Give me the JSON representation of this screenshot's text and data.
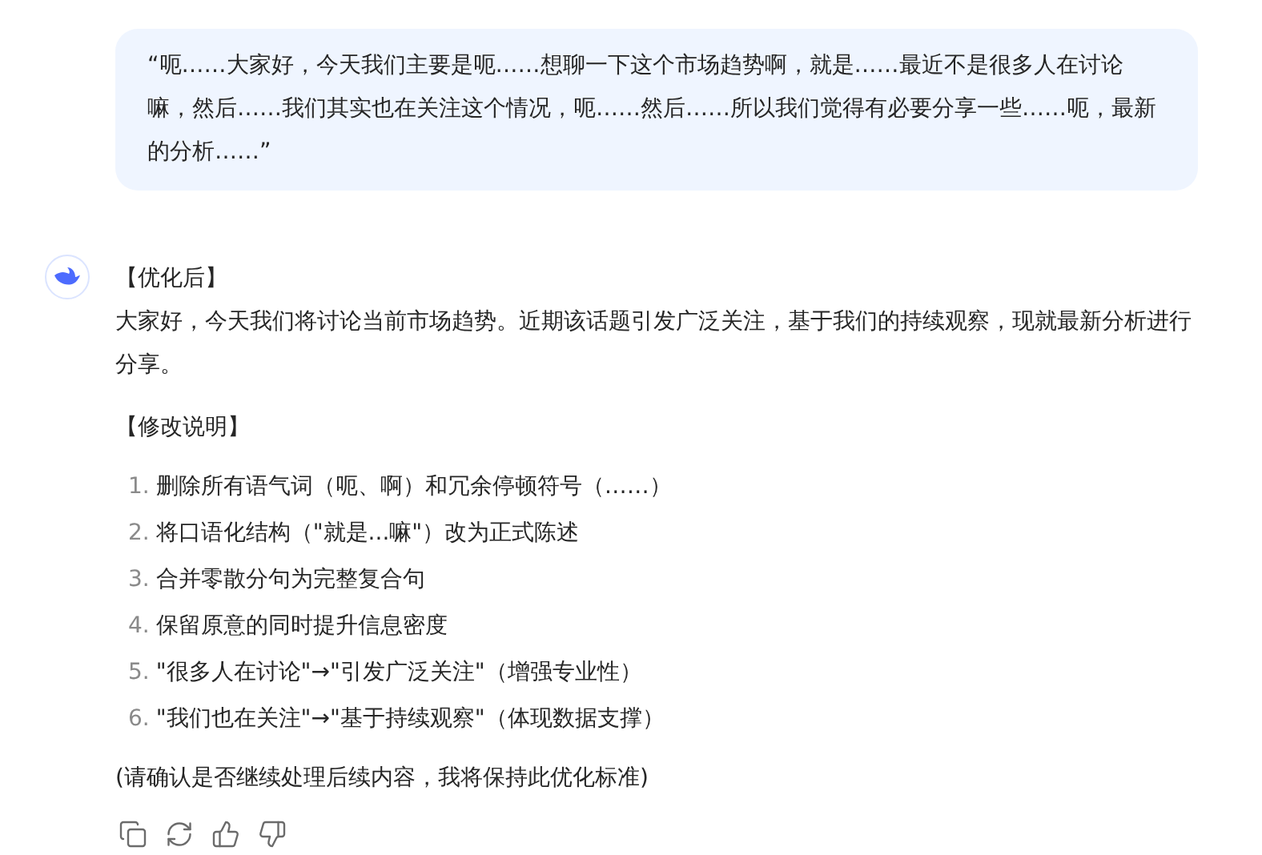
{
  "user_message": {
    "text": "“呃……大家好，今天我们主要是呃……想聊一下这个市场趋势啊，就是……最近不是很多人在讨论嘛，然后……我们其实也在关注这个情况，呃……然后……所以我们觉得有必要分享一些……呃，最新的分析……”"
  },
  "reply": {
    "heading": "【优化后】",
    "paragraph": "大家好，今天我们将讨论当前市场趋势。近期该话题引发广泛关注，基于我们的持续观察，现就最新分析进行分享。",
    "notes_heading": "【修改说明】",
    "notes": [
      {
        "number": "1.",
        "text": "删除所有语气词（呃、啊）和冗余停顿符号（……）"
      },
      {
        "number": "2.",
        "text": "将口语化结构（\"就是...嘛\"）改为正式陈述"
      },
      {
        "number": "3.",
        "text": "合并零散分句为完整复合句"
      },
      {
        "number": "4.",
        "text": "保留原意的同时提升信息密度"
      },
      {
        "number": "5.",
        "text": "\"很多人在讨论\"→\"引发广泛关注\"（增强专业性）"
      },
      {
        "number": "6.",
        "text": "\"我们也在关注\"→\"基于持续观察\"（体现数据支撑）"
      }
    ],
    "closing": "(请确认是否继续处理后续内容，我将保持此优化标准)"
  },
  "actions": [
    {
      "kind": "copy"
    },
    {
      "kind": "regenerate"
    },
    {
      "kind": "like"
    },
    {
      "kind": "dislike"
    }
  ]
}
